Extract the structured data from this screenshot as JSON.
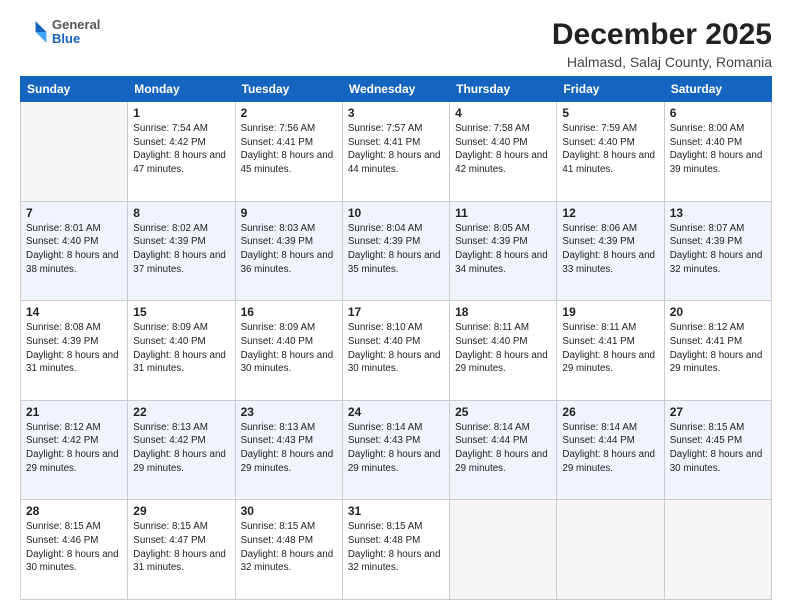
{
  "header": {
    "logo_general": "General",
    "logo_blue": "Blue",
    "month_title": "December 2025",
    "location": "Halmasd, Salaj County, Romania"
  },
  "weekdays": [
    "Sunday",
    "Monday",
    "Tuesday",
    "Wednesday",
    "Thursday",
    "Friday",
    "Saturday"
  ],
  "weeks": [
    [
      {
        "day": "",
        "empty": true
      },
      {
        "day": "1",
        "sunrise": "Sunrise: 7:54 AM",
        "sunset": "Sunset: 4:42 PM",
        "daylight": "Daylight: 8 hours and 47 minutes."
      },
      {
        "day": "2",
        "sunrise": "Sunrise: 7:56 AM",
        "sunset": "Sunset: 4:41 PM",
        "daylight": "Daylight: 8 hours and 45 minutes."
      },
      {
        "day": "3",
        "sunrise": "Sunrise: 7:57 AM",
        "sunset": "Sunset: 4:41 PM",
        "daylight": "Daylight: 8 hours and 44 minutes."
      },
      {
        "day": "4",
        "sunrise": "Sunrise: 7:58 AM",
        "sunset": "Sunset: 4:40 PM",
        "daylight": "Daylight: 8 hours and 42 minutes."
      },
      {
        "day": "5",
        "sunrise": "Sunrise: 7:59 AM",
        "sunset": "Sunset: 4:40 PM",
        "daylight": "Daylight: 8 hours and 41 minutes."
      },
      {
        "day": "6",
        "sunrise": "Sunrise: 8:00 AM",
        "sunset": "Sunset: 4:40 PM",
        "daylight": "Daylight: 8 hours and 39 minutes."
      }
    ],
    [
      {
        "day": "7",
        "sunrise": "Sunrise: 8:01 AM",
        "sunset": "Sunset: 4:40 PM",
        "daylight": "Daylight: 8 hours and 38 minutes."
      },
      {
        "day": "8",
        "sunrise": "Sunrise: 8:02 AM",
        "sunset": "Sunset: 4:39 PM",
        "daylight": "Daylight: 8 hours and 37 minutes."
      },
      {
        "day": "9",
        "sunrise": "Sunrise: 8:03 AM",
        "sunset": "Sunset: 4:39 PM",
        "daylight": "Daylight: 8 hours and 36 minutes."
      },
      {
        "day": "10",
        "sunrise": "Sunrise: 8:04 AM",
        "sunset": "Sunset: 4:39 PM",
        "daylight": "Daylight: 8 hours and 35 minutes."
      },
      {
        "day": "11",
        "sunrise": "Sunrise: 8:05 AM",
        "sunset": "Sunset: 4:39 PM",
        "daylight": "Daylight: 8 hours and 34 minutes."
      },
      {
        "day": "12",
        "sunrise": "Sunrise: 8:06 AM",
        "sunset": "Sunset: 4:39 PM",
        "daylight": "Daylight: 8 hours and 33 minutes."
      },
      {
        "day": "13",
        "sunrise": "Sunrise: 8:07 AM",
        "sunset": "Sunset: 4:39 PM",
        "daylight": "Daylight: 8 hours and 32 minutes."
      }
    ],
    [
      {
        "day": "14",
        "sunrise": "Sunrise: 8:08 AM",
        "sunset": "Sunset: 4:39 PM",
        "daylight": "Daylight: 8 hours and 31 minutes."
      },
      {
        "day": "15",
        "sunrise": "Sunrise: 8:09 AM",
        "sunset": "Sunset: 4:40 PM",
        "daylight": "Daylight: 8 hours and 31 minutes."
      },
      {
        "day": "16",
        "sunrise": "Sunrise: 8:09 AM",
        "sunset": "Sunset: 4:40 PM",
        "daylight": "Daylight: 8 hours and 30 minutes."
      },
      {
        "day": "17",
        "sunrise": "Sunrise: 8:10 AM",
        "sunset": "Sunset: 4:40 PM",
        "daylight": "Daylight: 8 hours and 30 minutes."
      },
      {
        "day": "18",
        "sunrise": "Sunrise: 8:11 AM",
        "sunset": "Sunset: 4:40 PM",
        "daylight": "Daylight: 8 hours and 29 minutes."
      },
      {
        "day": "19",
        "sunrise": "Sunrise: 8:11 AM",
        "sunset": "Sunset: 4:41 PM",
        "daylight": "Daylight: 8 hours and 29 minutes."
      },
      {
        "day": "20",
        "sunrise": "Sunrise: 8:12 AM",
        "sunset": "Sunset: 4:41 PM",
        "daylight": "Daylight: 8 hours and 29 minutes."
      }
    ],
    [
      {
        "day": "21",
        "sunrise": "Sunrise: 8:12 AM",
        "sunset": "Sunset: 4:42 PM",
        "daylight": "Daylight: 8 hours and 29 minutes."
      },
      {
        "day": "22",
        "sunrise": "Sunrise: 8:13 AM",
        "sunset": "Sunset: 4:42 PM",
        "daylight": "Daylight: 8 hours and 29 minutes."
      },
      {
        "day": "23",
        "sunrise": "Sunrise: 8:13 AM",
        "sunset": "Sunset: 4:43 PM",
        "daylight": "Daylight: 8 hours and 29 minutes."
      },
      {
        "day": "24",
        "sunrise": "Sunrise: 8:14 AM",
        "sunset": "Sunset: 4:43 PM",
        "daylight": "Daylight: 8 hours and 29 minutes."
      },
      {
        "day": "25",
        "sunrise": "Sunrise: 8:14 AM",
        "sunset": "Sunset: 4:44 PM",
        "daylight": "Daylight: 8 hours and 29 minutes."
      },
      {
        "day": "26",
        "sunrise": "Sunrise: 8:14 AM",
        "sunset": "Sunset: 4:44 PM",
        "daylight": "Daylight: 8 hours and 29 minutes."
      },
      {
        "day": "27",
        "sunrise": "Sunrise: 8:15 AM",
        "sunset": "Sunset: 4:45 PM",
        "daylight": "Daylight: 8 hours and 30 minutes."
      }
    ],
    [
      {
        "day": "28",
        "sunrise": "Sunrise: 8:15 AM",
        "sunset": "Sunset: 4:46 PM",
        "daylight": "Daylight: 8 hours and 30 minutes."
      },
      {
        "day": "29",
        "sunrise": "Sunrise: 8:15 AM",
        "sunset": "Sunset: 4:47 PM",
        "daylight": "Daylight: 8 hours and 31 minutes."
      },
      {
        "day": "30",
        "sunrise": "Sunrise: 8:15 AM",
        "sunset": "Sunset: 4:48 PM",
        "daylight": "Daylight: 8 hours and 32 minutes."
      },
      {
        "day": "31",
        "sunrise": "Sunrise: 8:15 AM",
        "sunset": "Sunset: 4:48 PM",
        "daylight": "Daylight: 8 hours and 32 minutes."
      },
      {
        "day": "",
        "empty": true
      },
      {
        "day": "",
        "empty": true
      },
      {
        "day": "",
        "empty": true
      }
    ]
  ]
}
